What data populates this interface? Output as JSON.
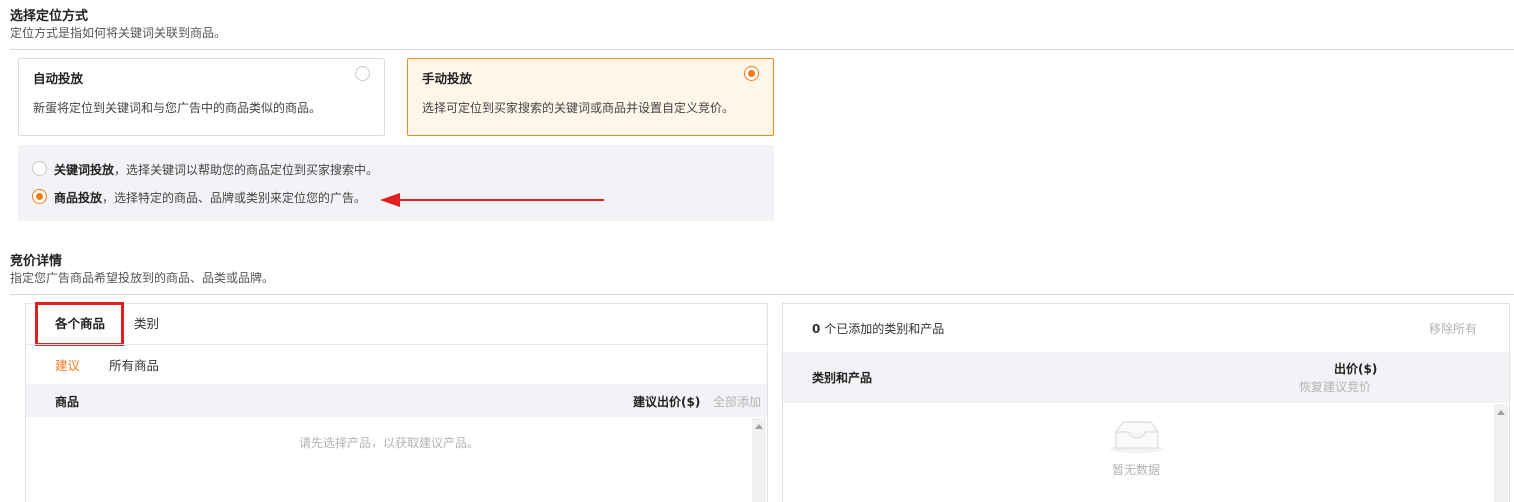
{
  "targeting": {
    "title": "选择定位方式",
    "description": "定位方式是指如何将关键词关联到商品。",
    "auto": {
      "label": "自动投放",
      "desc": "新蛋将定位到关键词和与您广告中的商品类似的商品。",
      "selected": false
    },
    "manual": {
      "label": "手动投放",
      "desc": "选择可定位到买家搜索的关键词或商品并设置自定义竞价。",
      "selected": true
    },
    "sub_options": [
      {
        "label": "关键词投放",
        "desc": "，选择关键词以帮助您的商品定位到买家搜索中。",
        "selected": false
      },
      {
        "label": "商品投放",
        "desc": "，选择特定的商品、品牌或类别来定位您的广告。",
        "selected": true
      }
    ]
  },
  "bidding": {
    "title": "竞价详情",
    "description": "指定您广告商品希望投放到的商品、品类或品牌。"
  },
  "left_panel": {
    "tabs": [
      "各个商品",
      "类别"
    ],
    "active_tab": 0,
    "subtabs": [
      "建议",
      "所有商品"
    ],
    "active_subtab": 0,
    "columns": {
      "product": "商品",
      "suggested_bid": "建议出价($)",
      "add_all": "全部添加"
    },
    "empty_text": "请先选择产品，以获取建议产品。"
  },
  "right_panel": {
    "added_count": "0",
    "added_text": "个已添加的类别和产品",
    "remove_all": "移除所有",
    "columns": {
      "category_product": "类别和产品",
      "bid": "出价($)",
      "restore": "恢复建议竞价"
    },
    "empty_text": "暂无数据"
  },
  "colors": {
    "accent": "#f07c18",
    "highlight_box": "#e02020",
    "arrow": "#e02020"
  }
}
